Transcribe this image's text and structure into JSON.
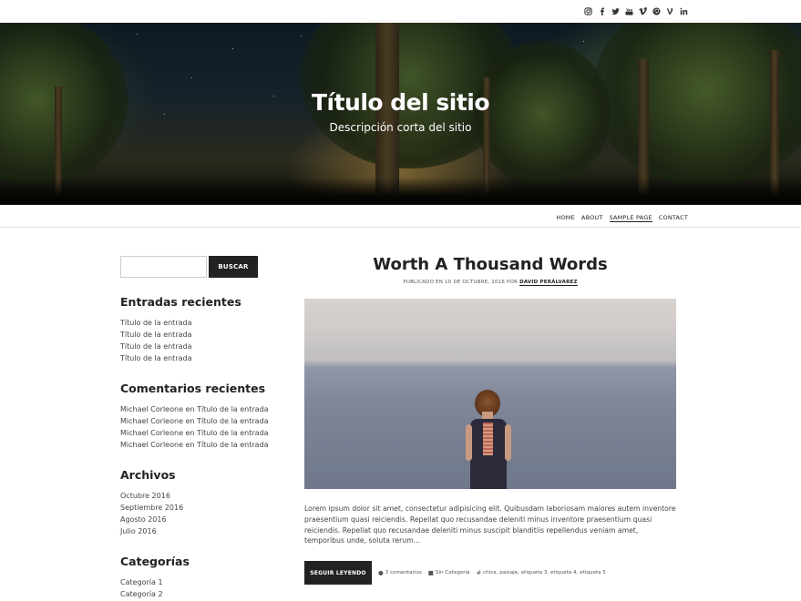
{
  "social": {
    "icons": [
      "instagram-icon",
      "facebook-icon",
      "twitter-icon",
      "youtube-icon",
      "vimeo-icon",
      "pinterest-icon",
      "vine-icon",
      "linkedin-icon"
    ]
  },
  "hero": {
    "title": "Título del sitio",
    "description": "Descripción corta del sitio"
  },
  "nav": {
    "items": [
      "HOME",
      "ABOUT",
      "SAMPLE PAGE",
      "CONTACT"
    ]
  },
  "sidebar": {
    "search_button": "BUSCAR",
    "recent_posts": {
      "title": "Entradas recientes",
      "items": [
        "Título de la entrada",
        "Título de la entrada",
        "Título de la entrada",
        "Título de la entrada"
      ]
    },
    "recent_comments": {
      "title": "Comentarios recientes",
      "items": [
        "Michael Corleone en Título de la entrada",
        "Michael Corleone en Título de la entrada",
        "Michael Corleone en Título de la entrada",
        "Michael Corleone en Título de la entrada"
      ]
    },
    "archives": {
      "title": "Archivos",
      "items": [
        "Octubre 2016",
        "Septiembre 2016",
        "Agosto 2016",
        "Julio 2016"
      ]
    },
    "categories": {
      "title": "Categorías",
      "items": [
        "Categoría 1",
        "Categoría 2"
      ]
    }
  },
  "post": {
    "title": "Worth A Thousand Words",
    "meta_prefix": "PUBLICADO EN 10 DE OCTUBRE, 2016 POR",
    "author": "DAVID PERÁLVAREZ",
    "excerpt": "Lorem ipsum dolor sit amet, consectetur adipisicing elit. Quibusdam laboriosam maiores autem inventore praesentium quasi reiciendis. Repellat quo recusandae deleniti minus inventore praesentium quasi reiciendis. Repellat quo recusandae deleniti minus suscipit blanditiis repellendus veniam amet, temporibus unde, soluta rerum...",
    "read_more": "SEGUIR LEYENDO",
    "comments": "3 comentarios",
    "category": "Sin Categoría",
    "tags": "chica, paisaje, etiqueta 3, etiqueta 4, etiqueta 5"
  }
}
